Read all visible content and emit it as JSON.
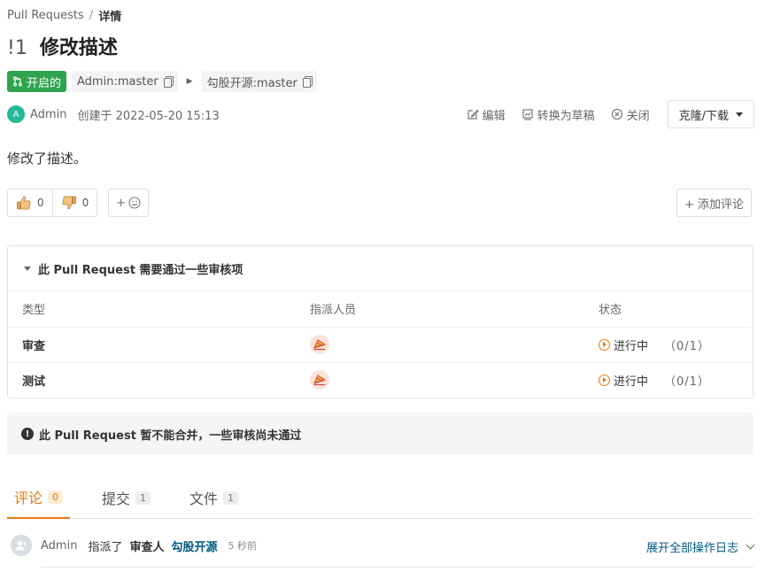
{
  "breadcrumb": {
    "link": "Pull Requests",
    "separator": "/",
    "current": "详情"
  },
  "pr": {
    "number": "!1",
    "title": "修改描述"
  },
  "status_badge": {
    "label": "开启的",
    "color": "#2ea44f"
  },
  "branches": {
    "source": "Admin:master",
    "target": "勾股开源:master"
  },
  "author": {
    "avatar_letter": "A",
    "name": "Admin",
    "created": "创建于 2022-05-20 15:13"
  },
  "actions": {
    "edit": "编辑",
    "to_draft": "转换为草稿",
    "close": "关闭",
    "clone": "克隆/下载"
  },
  "description": "修改了描述。",
  "reactions": {
    "thumbs_up": "0",
    "thumbs_down": "0",
    "add_emoji": "+"
  },
  "add_comment": "+ 添加评论",
  "review": {
    "title": "此 Pull Request 需要通过一些审核项",
    "headers": {
      "type": "类型",
      "assignee": "指派人员",
      "status": "状态"
    },
    "rows": [
      {
        "type": "审查",
        "status": "进行中",
        "count": "（0/1）"
      },
      {
        "type": "测试",
        "status": "进行中",
        "count": "（0/1）"
      }
    ]
  },
  "merge_warning": "此 Pull Request 暂不能合并，一些审核尚未通过",
  "tabs": [
    {
      "label": "评论",
      "count": "0",
      "active": true
    },
    {
      "label": "提交",
      "count": "1",
      "active": false
    },
    {
      "label": "文件",
      "count": "1",
      "active": false
    }
  ],
  "timeline": {
    "author": "Admin",
    "action": "指派了",
    "role": "审查人",
    "target": "勾股开源",
    "time": "5 秒前",
    "expand": "展开全部操作日志"
  },
  "colors": {
    "accent": "#e8780c",
    "link": "#005980",
    "success": "#2ea44f"
  }
}
